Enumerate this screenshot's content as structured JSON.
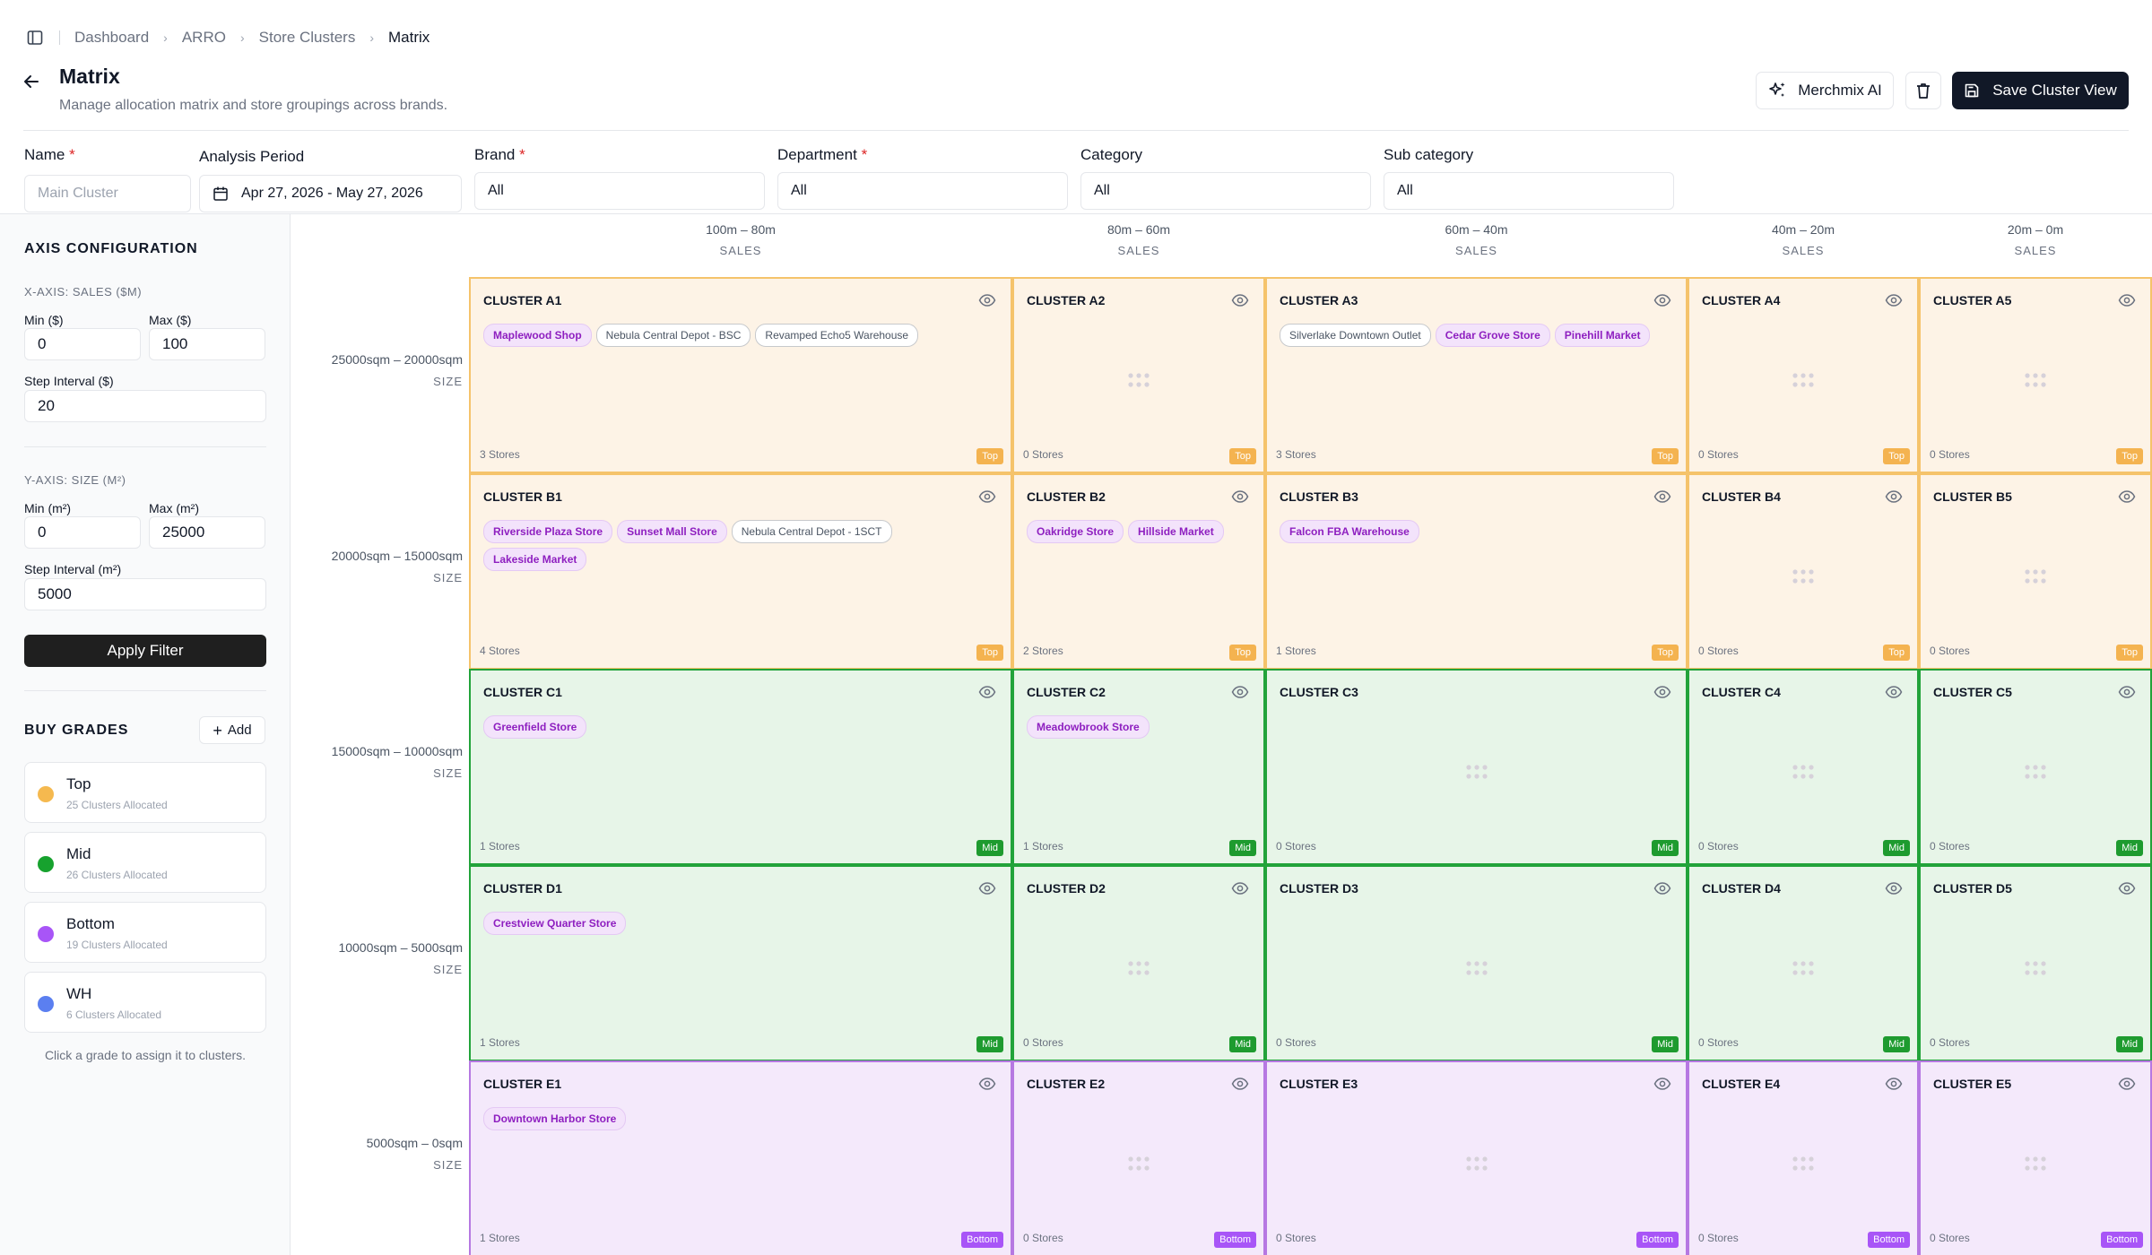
{
  "breadcrumb": [
    "Dashboard",
    "ARRO",
    "Store Clusters",
    "Matrix"
  ],
  "header": {
    "title": "Matrix",
    "subtitle": "Manage allocation matrix and store groupings across brands.",
    "ai_label": "Merchmix AI",
    "save_label": "Save Cluster View"
  },
  "filters": {
    "name": {
      "label": "Name",
      "placeholder": "Main Cluster"
    },
    "period": {
      "label": "Analysis Period",
      "value": "Apr 27, 2026 - May 27, 2026"
    },
    "brand": {
      "label": "Brand",
      "value": "All"
    },
    "department": {
      "label": "Department",
      "value": "All"
    },
    "category": {
      "label": "Category",
      "value": "All"
    },
    "subcategory": {
      "label": "Sub category",
      "value": "All"
    }
  },
  "sidebar": {
    "axis_title": "AXIS CONFIGURATION",
    "x_axis": {
      "title": "X-AXIS: SALES ($M)",
      "min_label": "Min ($)",
      "min": "0",
      "max_label": "Max ($)",
      "max": "100",
      "step_label": "Step Interval ($)",
      "step": "20"
    },
    "y_axis": {
      "title": "Y-AXIS: SIZE (M²)",
      "min_label": "Min (m²)",
      "min": "0",
      "max_label": "Max (m²)",
      "max": "25000",
      "step_label": "Step Interval (m²)",
      "step": "5000"
    },
    "apply_label": "Apply Filter",
    "grades_title": "BUY GRADES",
    "add_label": "Add",
    "grades": [
      {
        "name": "Top",
        "count": "25 Clusters Allocated",
        "color": "#f5b94f"
      },
      {
        "name": "Mid",
        "count": "26 Clusters Allocated",
        "color": "#17a22e"
      },
      {
        "name": "Bottom",
        "count": "19 Clusters Allocated",
        "color": "#a855f7"
      },
      {
        "name": "WH",
        "count": "6 Clusters Allocated",
        "color": "#5b7ff0"
      }
    ],
    "hint": "Click a grade to assign it to clusters."
  },
  "matrix": {
    "columns": [
      {
        "range": "100m – 80m",
        "axis": "SALES"
      },
      {
        "range": "80m – 60m",
        "axis": "SALES"
      },
      {
        "range": "60m – 40m",
        "axis": "SALES"
      },
      {
        "range": "40m – 20m",
        "axis": "SALES"
      },
      {
        "range": "20m – 0m",
        "axis": "SALES"
      }
    ],
    "rows": [
      {
        "range": "25000sqm – 20000sqm",
        "axis": "SIZE"
      },
      {
        "range": "20000sqm – 15000sqm",
        "axis": "SIZE"
      },
      {
        "range": "15000sqm – 10000sqm",
        "axis": "SIZE"
      },
      {
        "range": "10000sqm – 5000sqm",
        "axis": "SIZE"
      },
      {
        "range": "5000sqm – 0sqm",
        "axis": "SIZE"
      }
    ],
    "cells": [
      [
        {
          "name": "CLUSTER A1",
          "grade": "top",
          "badge": "Top",
          "count": "3 Stores",
          "stores": [
            {
              "name": "Maplewood Shop",
              "style": "purple"
            },
            {
              "name": "Nebula Central Depot - BSC",
              "style": "white"
            },
            {
              "name": "Revamped Echo5 Warehouse",
              "style": "white"
            }
          ]
        },
        {
          "name": "CLUSTER A2",
          "grade": "top",
          "badge": "Top",
          "count": "0 Stores",
          "stores": []
        },
        {
          "name": "CLUSTER A3",
          "grade": "top",
          "badge": "Top",
          "count": "3 Stores",
          "stores": [
            {
              "name": "Silverlake Downtown Outlet",
              "style": "white"
            },
            {
              "name": "Cedar Grove Store",
              "style": "purple"
            },
            {
              "name": "Pinehill Market",
              "style": "purple"
            }
          ]
        },
        {
          "name": "CLUSTER A4",
          "grade": "top",
          "badge": "Top",
          "count": "0 Stores",
          "stores": []
        },
        {
          "name": "CLUSTER A5",
          "grade": "top",
          "badge": "Top",
          "count": "0 Stores",
          "stores": []
        }
      ],
      [
        {
          "name": "CLUSTER B1",
          "grade": "top",
          "badge": "Top",
          "count": "4 Stores",
          "stores": [
            {
              "name": "Riverside Plaza Store",
              "style": "purple"
            },
            {
              "name": "Sunset Mall Store",
              "style": "purple"
            },
            {
              "name": "Nebula Central Depot - 1SCT",
              "style": "white"
            },
            {
              "name": "Lakeside Market",
              "style": "purple"
            }
          ]
        },
        {
          "name": "CLUSTER B2",
          "grade": "top",
          "badge": "Top",
          "count": "2 Stores",
          "stores": [
            {
              "name": "Oakridge Store",
              "style": "purple"
            },
            {
              "name": "Hillside Market",
              "style": "purple"
            }
          ]
        },
        {
          "name": "CLUSTER B3",
          "grade": "top",
          "badge": "Top",
          "count": "1 Stores",
          "stores": [
            {
              "name": "Falcon FBA Warehouse",
              "style": "purple"
            }
          ]
        },
        {
          "name": "CLUSTER B4",
          "grade": "top",
          "badge": "Top",
          "count": "0 Stores",
          "stores": []
        },
        {
          "name": "CLUSTER B5",
          "grade": "top",
          "badge": "Top",
          "count": "0 Stores",
          "stores": []
        }
      ],
      [
        {
          "name": "CLUSTER C1",
          "grade": "mid",
          "badge": "Mid",
          "count": "1 Stores",
          "stores": [
            {
              "name": "Greenfield Store",
              "style": "purple"
            }
          ]
        },
        {
          "name": "CLUSTER C2",
          "grade": "mid",
          "badge": "Mid",
          "count": "1 Stores",
          "stores": [
            {
              "name": "Meadowbrook Store",
              "style": "purple"
            }
          ]
        },
        {
          "name": "CLUSTER C3",
          "grade": "mid",
          "badge": "Mid",
          "count": "0 Stores",
          "stores": []
        },
        {
          "name": "CLUSTER C4",
          "grade": "mid",
          "badge": "Mid",
          "count": "0 Stores",
          "stores": []
        },
        {
          "name": "CLUSTER C5",
          "grade": "mid",
          "badge": "Mid",
          "count": "0 Stores",
          "stores": []
        }
      ],
      [
        {
          "name": "CLUSTER D1",
          "grade": "mid",
          "badge": "Mid",
          "count": "1 Stores",
          "stores": [
            {
              "name": "Crestview Quarter Store",
              "style": "purple"
            }
          ]
        },
        {
          "name": "CLUSTER D2",
          "grade": "mid",
          "badge": "Mid",
          "count": "0 Stores",
          "stores": []
        },
        {
          "name": "CLUSTER D3",
          "grade": "mid",
          "badge": "Mid",
          "count": "0 Stores",
          "stores": []
        },
        {
          "name": "CLUSTER D4",
          "grade": "mid",
          "badge": "Mid",
          "count": "0 Stores",
          "stores": []
        },
        {
          "name": "CLUSTER D5",
          "grade": "mid",
          "badge": "Mid",
          "count": "0 Stores",
          "stores": []
        }
      ],
      [
        {
          "name": "CLUSTER E1",
          "grade": "bottom",
          "badge": "Bottom",
          "count": "1 Stores",
          "stores": [
            {
              "name": "Downtown Harbor Store",
              "style": "purple"
            }
          ]
        },
        {
          "name": "CLUSTER E2",
          "grade": "bottom",
          "badge": "Bottom",
          "count": "0 Stores",
          "stores": []
        },
        {
          "name": "CLUSTER E3",
          "grade": "bottom",
          "badge": "Bottom",
          "count": "0 Stores",
          "stores": []
        },
        {
          "name": "CLUSTER E4",
          "grade": "bottom",
          "badge": "Bottom",
          "count": "0 Stores",
          "stores": []
        },
        {
          "name": "CLUSTER E5",
          "grade": "bottom",
          "badge": "Bottom",
          "count": "0 Stores",
          "stores": []
        }
      ]
    ]
  }
}
